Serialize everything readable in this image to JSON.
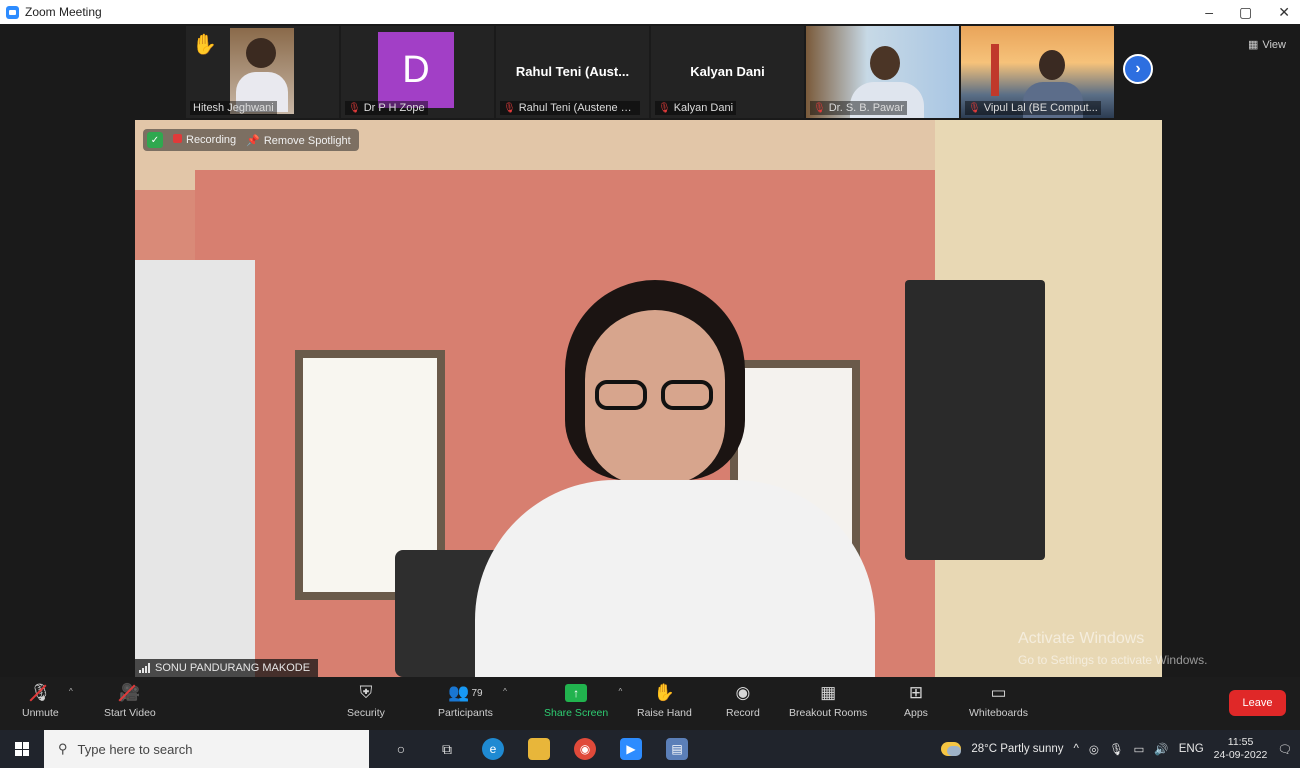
{
  "window": {
    "title": "Zoom Meeting",
    "controls": [
      "–",
      "▢",
      "✕"
    ]
  },
  "gallery": {
    "tiles": [
      {
        "name": "Hitesh Jeghwani",
        "type": "video",
        "raised_hand": true,
        "muted": false
      },
      {
        "name": "Dr P H Zope",
        "type": "avatar",
        "initial": "D",
        "muted": true
      },
      {
        "name": "Rahul Teni (Austene S...",
        "type": "name-only",
        "display_name": "Rahul Teni (Aust...",
        "muted": true
      },
      {
        "name": "Kalyan Dani",
        "type": "name-only",
        "display_name": "Kalyan Dani",
        "muted": true
      },
      {
        "name": "Dr. S. B. Pawar",
        "type": "video",
        "muted": true
      },
      {
        "name": "Vipul Lal (BE Comput...",
        "type": "video",
        "muted": true
      }
    ],
    "view_label": "View"
  },
  "main": {
    "speaker_name": "SONU PANDURANG MAKODE",
    "overlay": {
      "recording_label": "Recording",
      "spotlight_label": "Remove Spotlight"
    }
  },
  "watermark": {
    "line1": "Activate Windows",
    "line2": "Go to Settings to activate Windows."
  },
  "toolbar": {
    "unmute": "Unmute",
    "start_video": "Start Video",
    "security": "Security",
    "participants": "Participants",
    "participants_count": "79",
    "share_screen": "Share Screen",
    "raise_hand": "Raise Hand",
    "record": "Record",
    "breakout_rooms": "Breakout Rooms",
    "apps": "Apps",
    "whiteboards": "Whiteboards",
    "leave": "Leave"
  },
  "taskbar": {
    "search_placeholder": "Type here to search",
    "weather": "28°C  Partly sunny",
    "language": "ENG",
    "time": "11:55",
    "date": "24-09-2022"
  },
  "colors": {
    "accent": "#2d8cff",
    "leave": "#e02828",
    "share": "#21b34e",
    "avatar_d": "#a23fc6"
  }
}
